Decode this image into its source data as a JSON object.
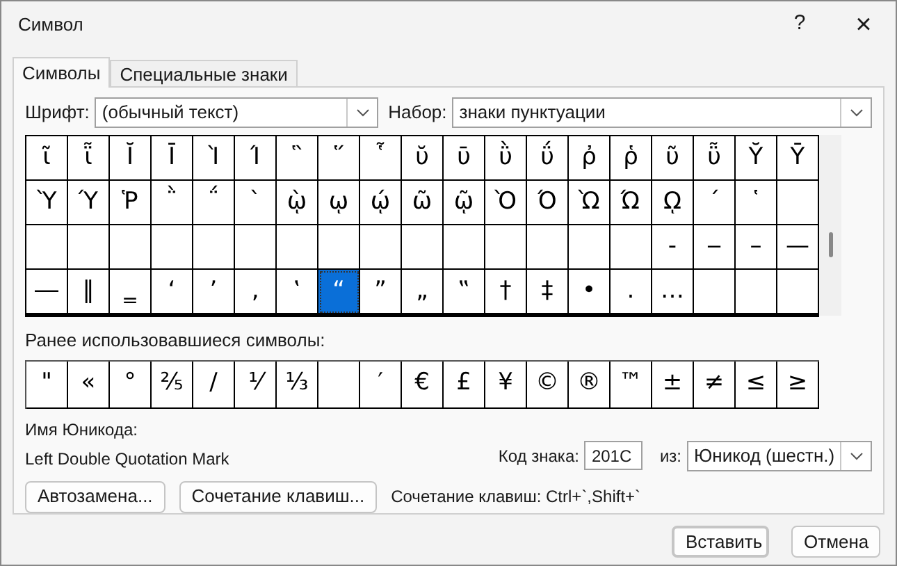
{
  "window": {
    "title": "Символ",
    "help": "?",
    "close": "×"
  },
  "tabs": [
    {
      "label": "Символы",
      "selected": true
    },
    {
      "label": "Специальные знаки",
      "selected": false
    }
  ],
  "font": {
    "label": "Шрифт:",
    "value": "(обычный текст)"
  },
  "subset": {
    "label": "Набор:",
    "value": "знаки пунктуации"
  },
  "grid": [
    [
      {
        "kind": "char",
        "char": "ῖ",
        "selected": false
      },
      {
        "kind": "char",
        "char": "ῗ",
        "selected": false
      },
      {
        "kind": "char",
        "char": "Ῐ",
        "selected": false
      },
      {
        "kind": "char",
        "char": "Ῑ",
        "selected": false
      },
      {
        "kind": "char",
        "char": "Ὶ",
        "selected": false
      },
      {
        "kind": "char",
        "char": "Ί",
        "selected": false
      },
      {
        "kind": "char",
        "char": "῝",
        "selected": false
      },
      {
        "kind": "char",
        "char": "῞",
        "selected": false
      },
      {
        "kind": "char",
        "char": "῟",
        "selected": false
      },
      {
        "kind": "char",
        "char": "ῠ",
        "selected": false
      },
      {
        "kind": "char",
        "char": "ῡ",
        "selected": false
      },
      {
        "kind": "char",
        "char": "ῢ",
        "selected": false
      },
      {
        "kind": "char",
        "char": "ΰ",
        "selected": false
      },
      {
        "kind": "char",
        "char": "ῤ",
        "selected": false
      },
      {
        "kind": "char",
        "char": "ῥ",
        "selected": false
      },
      {
        "kind": "char",
        "char": "ῦ",
        "selected": false
      },
      {
        "kind": "char",
        "char": "ῧ",
        "selected": false
      },
      {
        "kind": "char",
        "char": "Ῠ",
        "selected": false
      },
      {
        "kind": "char",
        "char": "Ῡ",
        "selected": false
      }
    ],
    [
      {
        "kind": "char",
        "char": "Ὺ",
        "selected": false
      },
      {
        "kind": "char",
        "char": "Ύ",
        "selected": false
      },
      {
        "kind": "char",
        "char": "Ῥ",
        "selected": false
      },
      {
        "kind": "char",
        "char": "῭",
        "selected": false
      },
      {
        "kind": "char",
        "char": "΅",
        "selected": false
      },
      {
        "kind": "char",
        "char": "`",
        "selected": false
      },
      {
        "kind": "char",
        "char": "ῲ",
        "selected": false
      },
      {
        "kind": "char",
        "char": "ῳ",
        "selected": false
      },
      {
        "kind": "char",
        "char": "ῴ",
        "selected": false
      },
      {
        "kind": "char",
        "char": "ῶ",
        "selected": false
      },
      {
        "kind": "char",
        "char": "ῷ",
        "selected": false
      },
      {
        "kind": "char",
        "char": "Ὸ",
        "selected": false
      },
      {
        "kind": "char",
        "char": "Ό",
        "selected": false
      },
      {
        "kind": "char",
        "char": "Ὼ",
        "selected": false
      },
      {
        "kind": "char",
        "char": "Ώ",
        "selected": false
      },
      {
        "kind": "char",
        "char": "ῼ",
        "selected": false
      },
      {
        "kind": "char",
        "char": "´",
        "selected": false
      },
      {
        "kind": "char",
        "char": "῾",
        "selected": false
      },
      {
        "kind": "blank"
      }
    ],
    [
      {
        "kind": "blank"
      },
      {
        "kind": "blank"
      },
      {
        "kind": "blank"
      },
      {
        "kind": "blank"
      },
      {
        "kind": "blank"
      },
      {
        "kind": "blank"
      },
      {
        "kind": "blank"
      },
      {
        "kind": "blank"
      },
      {
        "kind": "blank"
      },
      {
        "kind": "blank"
      },
      {
        "kind": "blank"
      },
      {
        "kind": "blank"
      },
      {
        "kind": "blank"
      },
      {
        "kind": "blank"
      },
      {
        "kind": "blank"
      },
      {
        "kind": "char",
        "char": "‑",
        "selected": false
      },
      {
        "kind": "char",
        "char": "‒",
        "selected": false
      },
      {
        "kind": "char",
        "char": "–",
        "selected": false
      },
      {
        "kind": "char",
        "char": "—",
        "selected": false
      }
    ],
    [
      {
        "kind": "char",
        "char": "―",
        "selected": false
      },
      {
        "kind": "char",
        "char": "‖",
        "selected": false
      },
      {
        "kind": "char",
        "char": "‗",
        "selected": false
      },
      {
        "kind": "char",
        "char": "‘",
        "selected": false
      },
      {
        "kind": "char",
        "char": "’",
        "selected": false
      },
      {
        "kind": "char",
        "char": "‚",
        "selected": false
      },
      {
        "kind": "char",
        "char": "‛",
        "selected": false
      },
      {
        "kind": "char",
        "char": "“",
        "selected": true
      },
      {
        "kind": "char",
        "char": "”",
        "selected": false
      },
      {
        "kind": "char",
        "char": "„",
        "selected": false
      },
      {
        "kind": "char",
        "char": "‟",
        "selected": false
      },
      {
        "kind": "char",
        "char": "†",
        "selected": false
      },
      {
        "kind": "char",
        "char": "‡",
        "selected": false
      },
      {
        "kind": "char",
        "char": "•",
        "selected": false
      },
      {
        "kind": "char",
        "char": "․",
        "selected": false
      },
      {
        "kind": "char",
        "char": "…",
        "selected": false
      },
      {
        "kind": "blank"
      },
      {
        "kind": "blank"
      },
      {
        "kind": "blank"
      }
    ]
  ],
  "recent": {
    "label": "Ранее использовавшиеся символы:",
    "cells": [
      {
        "kind": "char",
        "char": "\""
      },
      {
        "kind": "char",
        "char": "«"
      },
      {
        "kind": "char",
        "char": "°"
      },
      {
        "kind": "char",
        "char": "⅖"
      },
      {
        "kind": "char",
        "char": "∕"
      },
      {
        "kind": "char",
        "char": "⅟"
      },
      {
        "kind": "char",
        "char": "⅓"
      },
      {
        "kind": "blank"
      },
      {
        "kind": "char",
        "char": "′"
      },
      {
        "kind": "char",
        "char": "€"
      },
      {
        "kind": "char",
        "char": "£"
      },
      {
        "kind": "char",
        "char": "¥"
      },
      {
        "kind": "char",
        "char": "©"
      },
      {
        "kind": "char",
        "char": "®"
      },
      {
        "kind": "char",
        "char": "™"
      },
      {
        "kind": "char",
        "char": "±"
      },
      {
        "kind": "char",
        "char": "≠"
      },
      {
        "kind": "char",
        "char": "≤"
      },
      {
        "kind": "char",
        "char": "≥"
      }
    ]
  },
  "unicode_name": {
    "label": "Имя Юникода:",
    "value": "Left Double Quotation Mark"
  },
  "char_code": {
    "label": "Код знака:",
    "value": "201C"
  },
  "from": {
    "label": "из:",
    "value": "Юникод (шестн.)"
  },
  "autocorrect_button": "Автозамена...",
  "shortcut_button": "Сочетание клавиш...",
  "shortcut_text": "Сочетание клавиш: Ctrl+`,Shift+`",
  "insert_button": "Вставить",
  "cancel_button": "Отмена"
}
